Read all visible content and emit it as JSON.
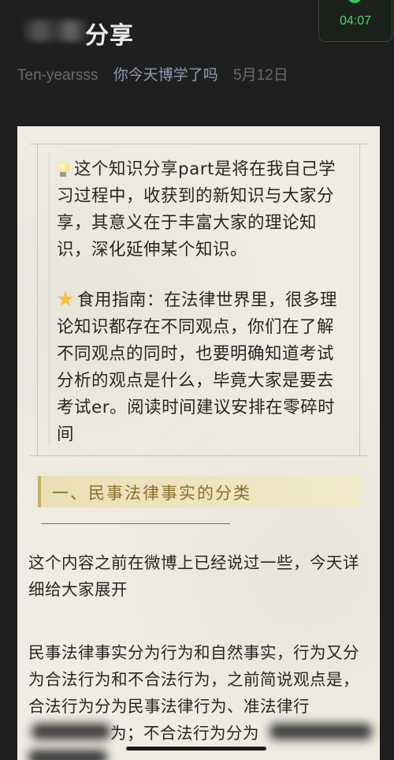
{
  "header": {
    "title_visible": "分享",
    "call_time": "04:07",
    "author": "Ten-yearsss",
    "account": "你今天博学了吗",
    "date": "5月12日"
  },
  "intro": {
    "para1": "这个知识分享part是将在我自己学习过程中，收获到的新知识与大家分享，其意义在于丰富大家的理论知识，深化延伸某个知识。",
    "para2": "食用指南：在法律世界里，很多理论知识都存在不同观点，你们在了解不同观点的同时，也要明确知道考试分析的观点是什么，毕竟大家是要去考试er。阅读时间建议安排在零碎时间"
  },
  "section": {
    "title": "一、民事法律事实的分类"
  },
  "body": {
    "p1": "这个内容之前在微博上已经说过一些，今天详细给大家展开",
    "p2": "民事法律事实分为行为和自然事实，行为又分为合法行为和不合法行为，之前简说观点是，合法行为分为民事法律行为、准法律行",
    "p2_tail": "为；不合法行为分为"
  },
  "icons": {
    "bulb": "lightbulb-icon",
    "star": "star-icon",
    "call": "phone-call-icon"
  }
}
